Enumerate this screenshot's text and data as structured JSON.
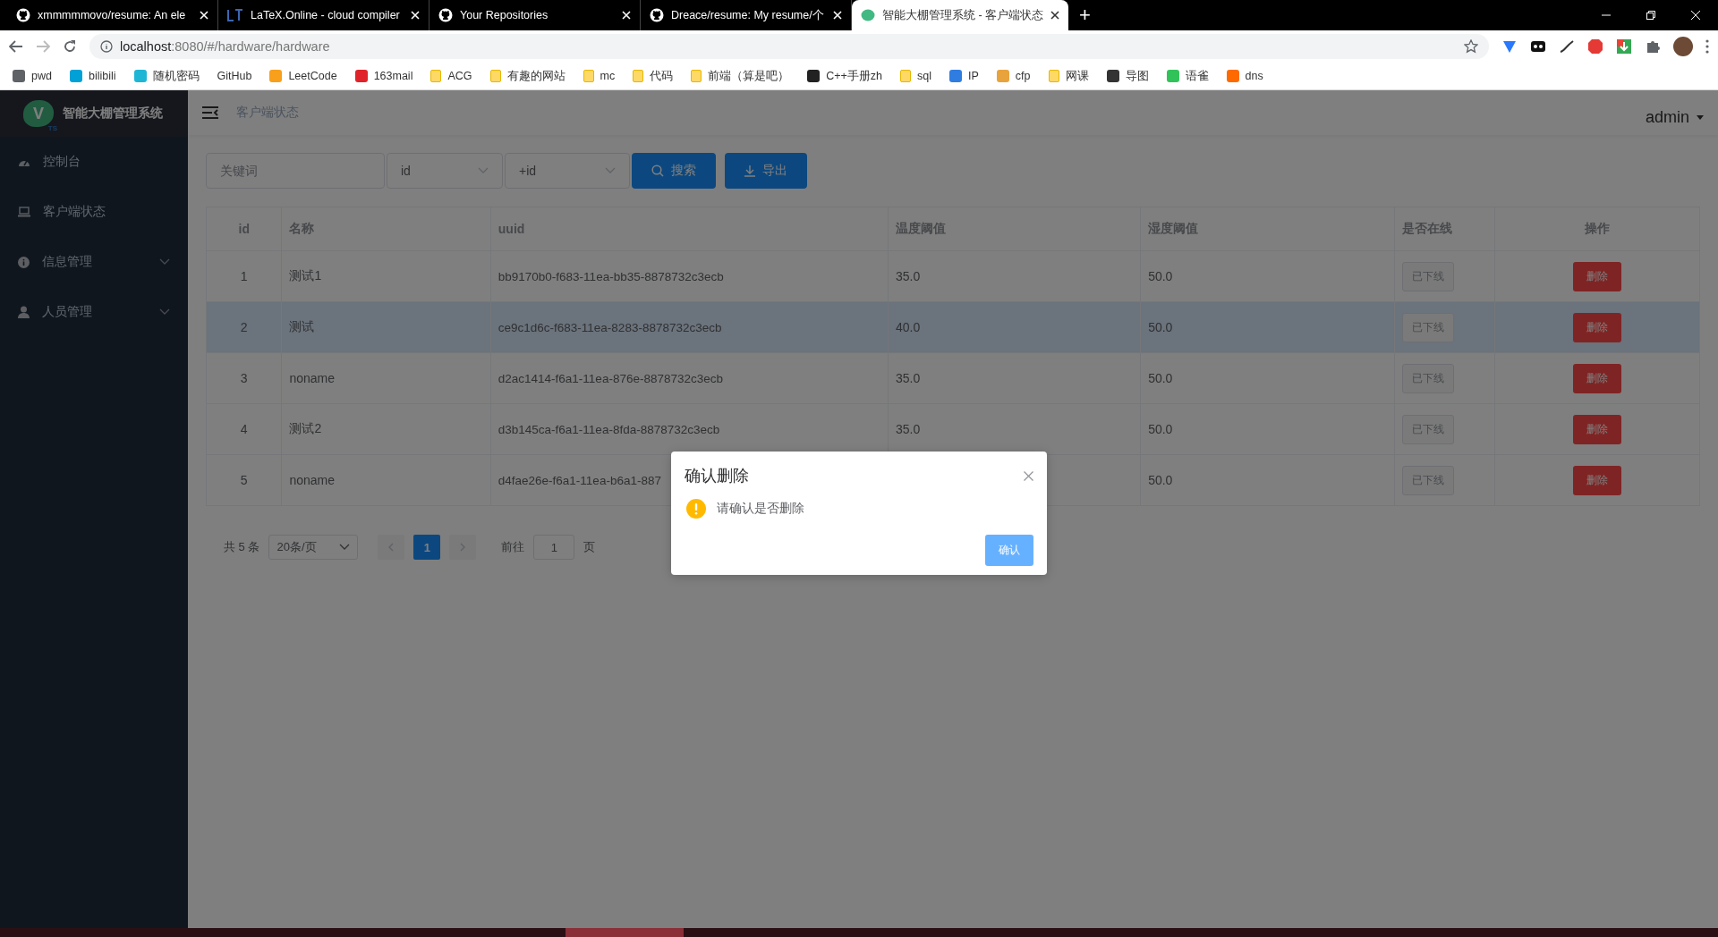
{
  "browser": {
    "tabs": [
      {
        "title": "xmmmmmovo/resume: An ele",
        "kind": "github",
        "selected": false
      },
      {
        "title": "LaTeX.Online - cloud compiler",
        "kind": "latex",
        "selected": false
      },
      {
        "title": "Your Repositories",
        "kind": "github",
        "selected": false
      },
      {
        "title": "Dreace/resume: My resume/个",
        "kind": "github",
        "selected": false
      },
      {
        "title": "智能大棚管理系统 - 客户端状态",
        "kind": "app",
        "selected": true
      }
    ],
    "new_tab": "+",
    "url_host": "localhost",
    "url_rest": ":8080/#/hardware/hardware",
    "bookmarks": [
      {
        "label": "pwd",
        "kind": "site",
        "color": "#5f6368"
      },
      {
        "label": "bilibili",
        "kind": "site",
        "color": "#00a1d6"
      },
      {
        "label": "随机密码",
        "kind": "site",
        "color": "#1fb6d6"
      },
      {
        "label": "GitHub",
        "kind": "text"
      },
      {
        "label": "LeetCode",
        "kind": "site",
        "color": "#f89f1b"
      },
      {
        "label": "163mail",
        "kind": "site",
        "color": "#e0232a"
      },
      {
        "label": "ACG",
        "kind": "folder"
      },
      {
        "label": "有趣的网站",
        "kind": "folder"
      },
      {
        "label": "mc",
        "kind": "folder"
      },
      {
        "label": "代码",
        "kind": "folder"
      },
      {
        "label": "前端（算是吧）",
        "kind": "folder"
      },
      {
        "label": "C++手册zh",
        "kind": "site",
        "color": "#222222"
      },
      {
        "label": "sql",
        "kind": "folder"
      },
      {
        "label": "IP",
        "kind": "site",
        "color": "#2f7de1"
      },
      {
        "label": "cfp",
        "kind": "site",
        "color": "#e8a33c"
      },
      {
        "label": "网课",
        "kind": "folder"
      },
      {
        "label": "导图",
        "kind": "site",
        "color": "#333333"
      },
      {
        "label": "语雀",
        "kind": "site",
        "color": "#31c35a"
      },
      {
        "label": "dns",
        "kind": "site",
        "color": "#ff6a00"
      }
    ]
  },
  "app": {
    "logo": {
      "letter": "V",
      "sub": "TS"
    },
    "brand": "智能大棚管理系统",
    "breadcrumb": "客户端状态",
    "user": "admin",
    "sidebar": [
      {
        "label": "控制台",
        "kind": "dashboard",
        "expandable": false
      },
      {
        "label": "客户端状态",
        "kind": "monitor",
        "expandable": false
      },
      {
        "label": "信息管理",
        "kind": "info",
        "expandable": true
      },
      {
        "label": "人员管理",
        "kind": "person",
        "expandable": true
      }
    ],
    "filters": {
      "keyword": {
        "placeholder": "关键词"
      },
      "field": "id",
      "order": "+id",
      "search": "搜索",
      "export": "导出"
    },
    "table": {
      "columns": [
        "id",
        "名称",
        "uuid",
        "温度阈值",
        "湿度阈值",
        "是否在线",
        "操作"
      ],
      "rows": [
        {
          "id": "1",
          "name": "测试1",
          "uuid": "bb9170b0-f683-11ea-bb35-8878732c3ecb",
          "temp": "35.0",
          "humidity": "50.0",
          "status": "已下线",
          "action": "删除",
          "selected": false
        },
        {
          "id": "2",
          "name": "测试",
          "uuid": "ce9c1d6c-f683-11ea-8283-8878732c3ecb",
          "temp": "40.0",
          "humidity": "50.0",
          "status": "已下线",
          "action": "删除",
          "selected": true
        },
        {
          "id": "3",
          "name": "noname",
          "uuid": "d2ac1414-f6a1-11ea-876e-8878732c3ecb",
          "temp": "35.0",
          "humidity": "50.0",
          "status": "已下线",
          "action": "删除",
          "selected": false
        },
        {
          "id": "4",
          "name": "测试2",
          "uuid": "d3b145ca-f6a1-11ea-8fda-8878732c3ecb",
          "temp": "35.0",
          "humidity": "50.0",
          "status": "已下线",
          "action": "删除",
          "selected": false
        },
        {
          "id": "5",
          "name": "noname",
          "uuid": "d4fae26e-f6a1-11ea-b6a1-887",
          "humidity": "50.0",
          "status": "已下线",
          "action": "删除",
          "selected": false
        }
      ]
    },
    "pagination": {
      "total": "共 5 条",
      "page_size": "20条/页",
      "pages": [
        {
          "label": "1",
          "selected": true
        }
      ],
      "goto": "前往",
      "goto_value": "1",
      "goto_unit": "页"
    },
    "dialog": {
      "title": "确认删除",
      "message": "请确认是否删除",
      "confirm": "确认"
    }
  }
}
